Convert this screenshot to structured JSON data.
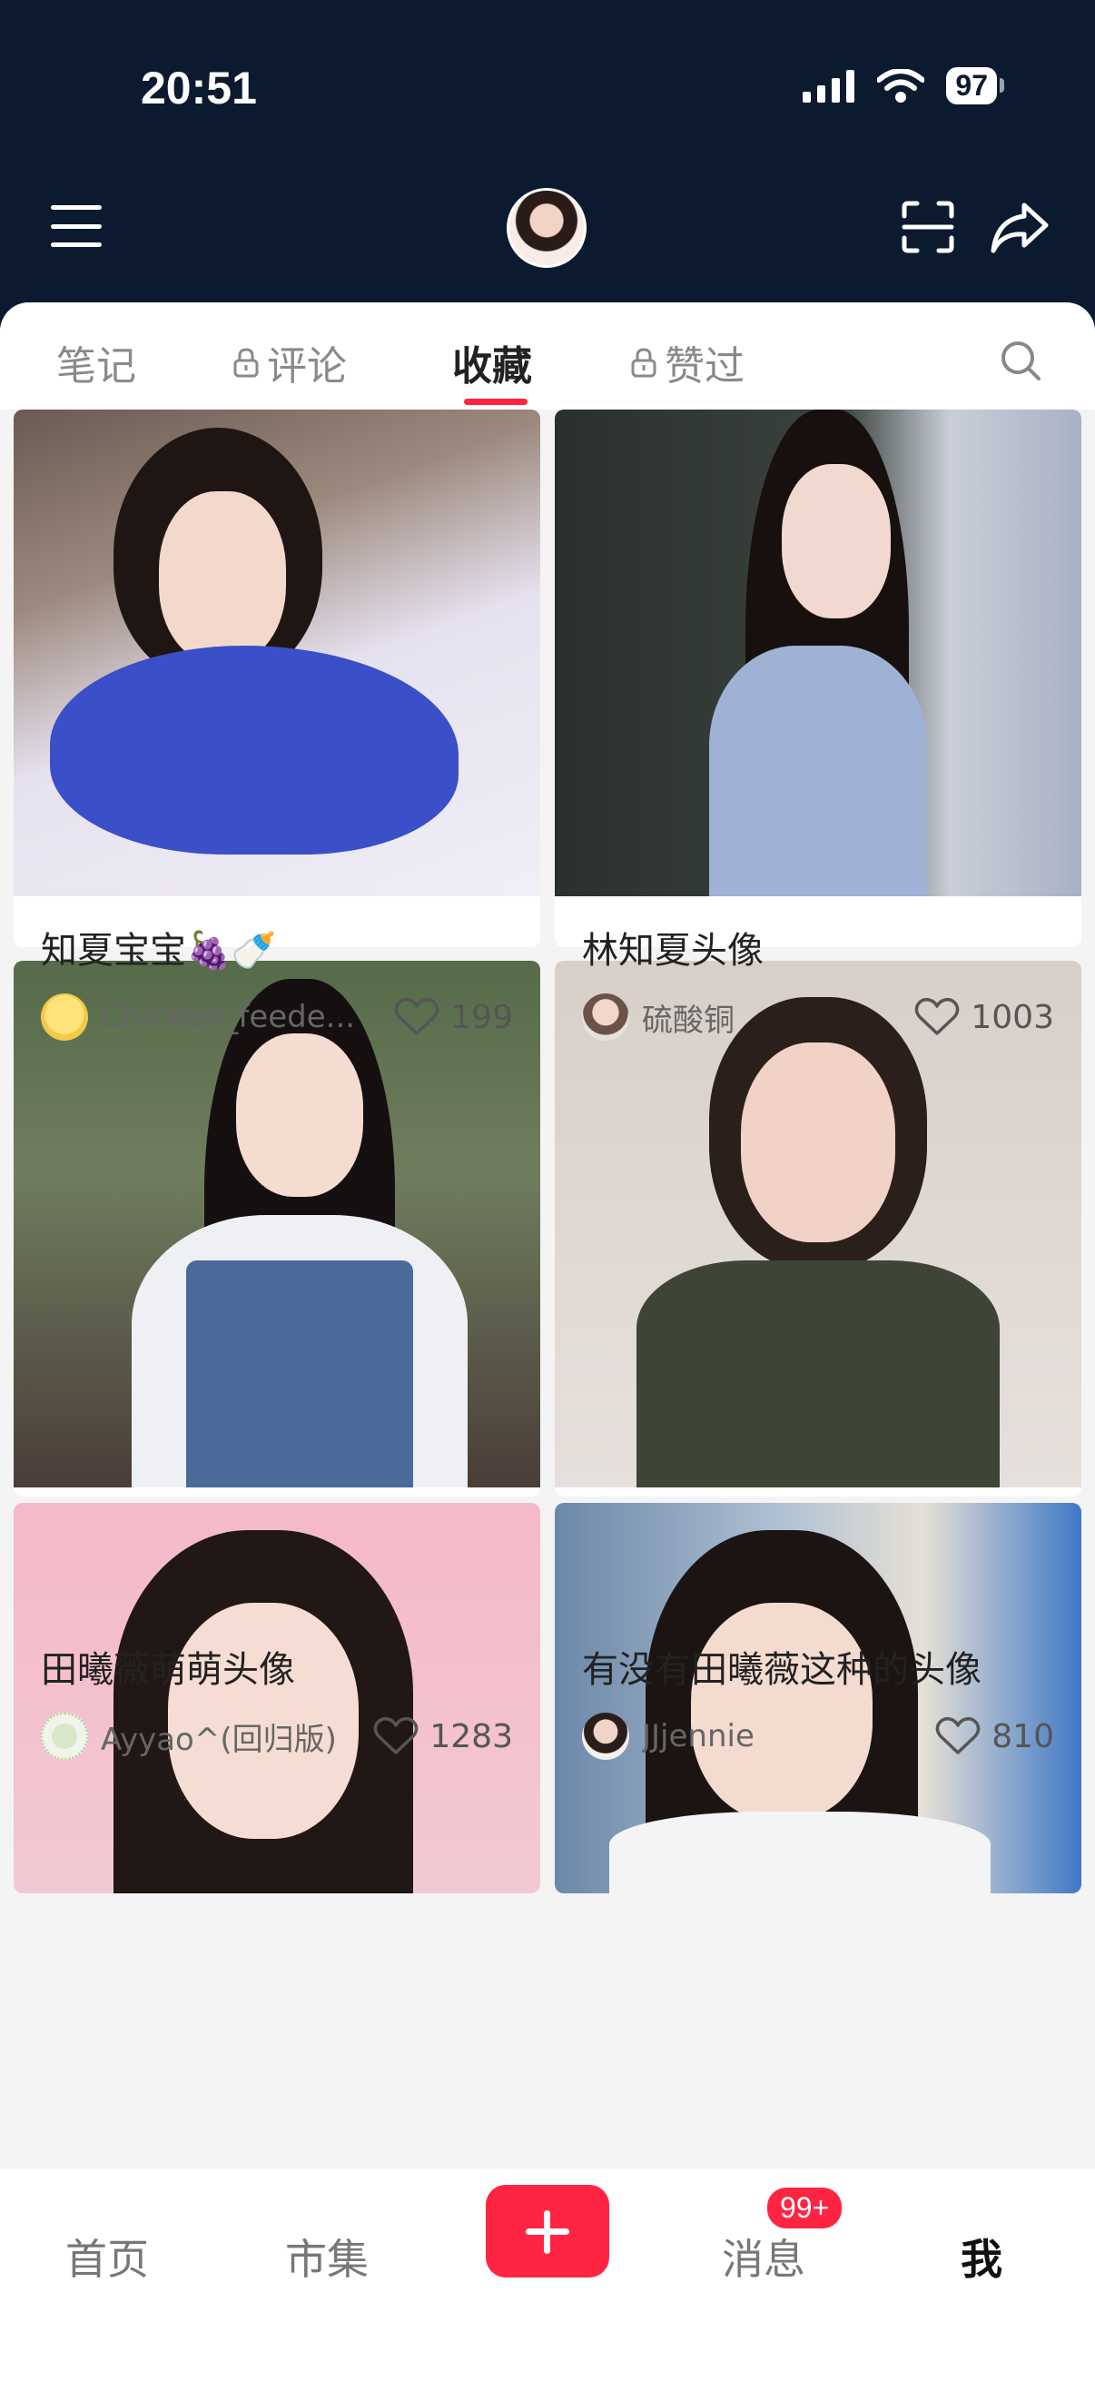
{
  "status_bar": {
    "time": "20:51",
    "battery": "97"
  },
  "tabs": [
    {
      "label": "笔记",
      "locked": false,
      "active": false
    },
    {
      "label": "评论",
      "locked": true,
      "active": false
    },
    {
      "label": "收藏",
      "locked": false,
      "active": true
    },
    {
      "label": "赞过",
      "locked": true,
      "active": false
    }
  ],
  "notes": [
    {
      "title": "知夏宝宝🍇🍼",
      "author": "Chicken_feede...",
      "likes": "199"
    },
    {
      "title": "林知夏头像",
      "author": "硫酸铜",
      "likes": "1003"
    },
    {
      "title": "田曦薇萌萌头像",
      "author": "Ayyao^(回归版)",
      "likes": "1283"
    },
    {
      "title": "有没有田曦薇这种的头像",
      "author": "JJjennie",
      "likes": "810"
    }
  ],
  "bottom_nav": {
    "home": "首页",
    "market": "市集",
    "messages": "消息",
    "messages_badge": "99+",
    "me": "我"
  },
  "colors": {
    "header_bg": "#0c1a30",
    "accent": "#ff2442"
  }
}
